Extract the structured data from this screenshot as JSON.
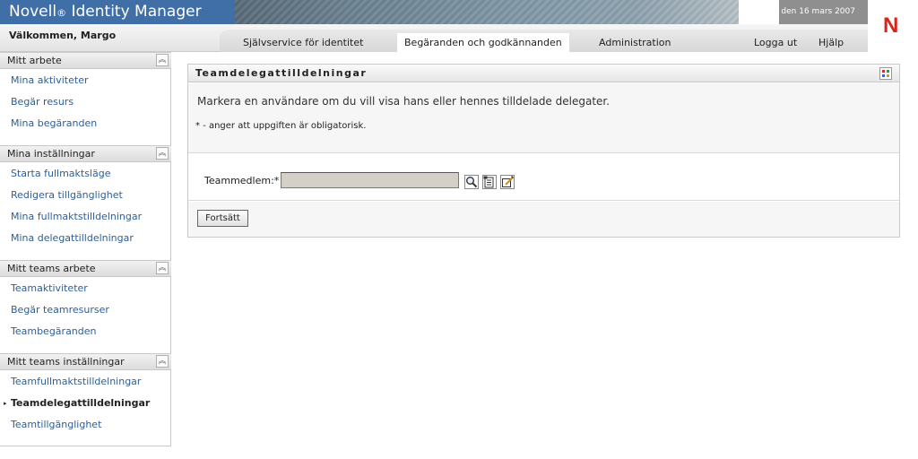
{
  "header": {
    "brand_name": "Novell",
    "brand_reg": "®",
    "brand_product": "Identity Manager",
    "date": "den 16 mars 2007",
    "welcome": "Välkommen, Margo",
    "logo_letter": "N",
    "tabs": [
      {
        "label": "Självservice för identitet",
        "active": false
      },
      {
        "label": "Begäranden och godkännanden",
        "active": true
      },
      {
        "label": "Administration",
        "active": false
      }
    ],
    "logout": "Logga ut",
    "help": "Hjälp"
  },
  "sidebar": {
    "sections": [
      {
        "title": "Mitt arbete",
        "items": [
          "Mina aktiviteter",
          "Begär resurs",
          "Mina begäranden"
        ]
      },
      {
        "title": "Mina inställningar",
        "items": [
          "Starta fullmaktsläge",
          "Redigera tillgänglighet",
          "Mina fullmaktstilldelningar",
          "Mina delegattilldelningar"
        ]
      },
      {
        "title": "Mitt teams arbete",
        "items": [
          "Teamaktiviteter",
          "Begär teamresurser",
          "Teambegäranden"
        ]
      },
      {
        "title": "Mitt teams inställningar",
        "items": [
          "Teamfullmaktstilldelningar",
          "Teamdelegattilldelningar",
          "Teamtillgänglighet"
        ]
      }
    ],
    "active_item": "Teamdelegattilldelningar"
  },
  "panel": {
    "title": "Teamdelegattilldelningar",
    "instruction": "Markera en användare om du vill visa hans eller hennes tilldelade delegater.",
    "required_note": "* - anger att uppgiften är obligatorisk.",
    "field_label": "Teammedlem:*",
    "field_value": "",
    "continue_label": "Fortsätt"
  },
  "colors": {
    "brand_blue": "#3f6fa6",
    "link_blue": "#2c5e9a",
    "novell_red": "#d9231d"
  },
  "icons": [
    "collapse-icon",
    "grid-icon",
    "search-icon",
    "history-icon",
    "edit-icon"
  ]
}
